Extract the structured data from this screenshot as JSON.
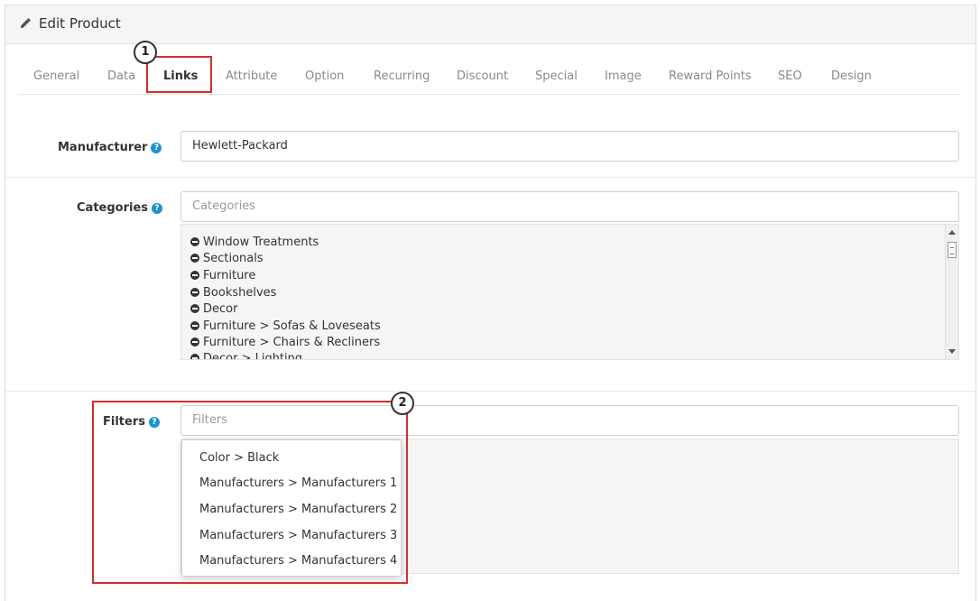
{
  "panel": {
    "title": "Edit Product",
    "title_icon": "pencil-icon"
  },
  "tabs": [
    {
      "label": "General",
      "active": false
    },
    {
      "label": "Data",
      "active": false
    },
    {
      "label": "Links",
      "active": true
    },
    {
      "label": "Attribute",
      "active": false
    },
    {
      "label": "Option",
      "active": false
    },
    {
      "label": "Recurring",
      "active": false
    },
    {
      "label": "Discount",
      "active": false
    },
    {
      "label": "Special",
      "active": false
    },
    {
      "label": "Image",
      "active": false
    },
    {
      "label": "Reward Points",
      "active": false
    },
    {
      "label": "SEO",
      "active": false
    },
    {
      "label": "Design",
      "active": false
    }
  ],
  "form": {
    "manufacturer": {
      "label": "Manufacturer",
      "value": "Hewlett-Packard",
      "help_icon": "?"
    },
    "categories": {
      "label": "Categories",
      "placeholder": "Categories",
      "help_icon": "?",
      "selected": [
        "Window Treatments",
        "Sectionals",
        "Furniture",
        "Bookshelves",
        "Decor",
        "Furniture > Sofas & Loveseats",
        "Furniture > Chairs & Recliners",
        "Decor > Lighting"
      ]
    },
    "filters": {
      "label": "Filters",
      "placeholder": "Filters",
      "help_icon": "?",
      "dropdown_options": [
        "Color > Black",
        "Manufacturers > Manufacturers 1",
        "Manufacturers > Manufacturers 2",
        "Manufacturers > Manufacturers 3",
        "Manufacturers > Manufacturers 4"
      ]
    }
  },
  "annotations": {
    "callout_1": "1",
    "callout_2": "2",
    "highlight_color": "#d62d2d"
  },
  "colors": {
    "help_icon": "#1e91cf",
    "tab_inactive": "#8a8a8a",
    "tab_active": "#333333"
  }
}
